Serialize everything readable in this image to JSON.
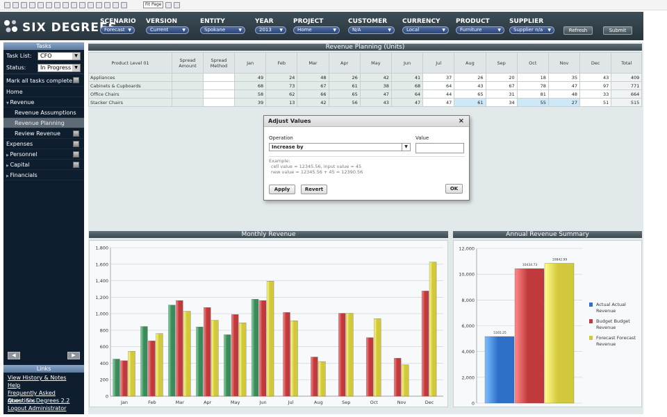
{
  "brand": {
    "name": "SIX DEGREES"
  },
  "toolbar": {
    "zoom": "Fit Page"
  },
  "filters": [
    {
      "label": "SCENARIO",
      "value": "Forecast"
    },
    {
      "label": "VERSION",
      "value": "Current"
    },
    {
      "label": "ENTITY",
      "value": "Spokane"
    },
    {
      "label": "YEAR",
      "value": "2013"
    },
    {
      "label": "PROJECT",
      "value": "Home"
    },
    {
      "label": "CUSTOMER",
      "value": "N/A"
    },
    {
      "label": "CURRENCY",
      "value": "Local"
    },
    {
      "label": "PRODUCT",
      "value": "Furniture"
    },
    {
      "label": "SUPPLIER",
      "value": "Supplier n/a"
    }
  ],
  "buttons": {
    "refresh": "Refresh",
    "submit": "Submit"
  },
  "tasks": {
    "title": "Tasks",
    "task_list_label": "Task List:",
    "task_list_value": "CFO",
    "status_label": "Status:",
    "status_value": "In Progress",
    "mark_all": "Mark all tasks complete",
    "items": [
      {
        "label": "Home",
        "indent": 0,
        "arrow": "",
        "checkbox": false,
        "selected": false
      },
      {
        "label": "Revenue",
        "indent": 0,
        "arrow": "▼",
        "checkbox": false,
        "selected": false
      },
      {
        "label": "Revenue Assumptions",
        "indent": 1,
        "arrow": "",
        "checkbox": false,
        "selected": false
      },
      {
        "label": "Revenue Planning",
        "indent": 1,
        "arrow": "",
        "checkbox": false,
        "selected": true
      },
      {
        "label": "Review Revenue",
        "indent": 1,
        "arrow": "",
        "checkbox": true,
        "selected": false
      },
      {
        "label": "Expenses",
        "indent": 0,
        "arrow": "",
        "checkbox": true,
        "selected": false
      },
      {
        "label": "Personnel",
        "indent": 0,
        "arrow": "▶",
        "checkbox": true,
        "selected": false
      },
      {
        "label": "Capital",
        "indent": 0,
        "arrow": "▶",
        "checkbox": true,
        "selected": false
      },
      {
        "label": "Financials",
        "indent": 0,
        "arrow": "▶",
        "checkbox": false,
        "selected": false
      }
    ]
  },
  "links": {
    "title": "Links",
    "items": [
      "View History & Notes",
      "Help",
      "Frequently Asked Questions",
      "About Six Degrees 2.2",
      "Logout Administrator"
    ]
  },
  "planning": {
    "title": "Revenue Planning (Units)",
    "headers": [
      "Product Level 01",
      "Spread Amount",
      "Spread Method",
      "Jan",
      "Feb",
      "Mar",
      "Apr",
      "May",
      "Jun",
      "Jul",
      "Aug",
      "Sep",
      "Oct",
      "Nov",
      "Dec",
      "Total"
    ],
    "rows": [
      {
        "label": "Appliances",
        "values": [
          49,
          24,
          48,
          26,
          42,
          41,
          37,
          26,
          20,
          18,
          35,
          43
        ],
        "total": 409
      },
      {
        "label": "Cabinets & Cupboards",
        "values": [
          68,
          73,
          67,
          61,
          38,
          68,
          64,
          43,
          67,
          78,
          47,
          97
        ],
        "total": 771
      },
      {
        "label": "Office Chairs",
        "values": [
          58,
          62,
          66,
          65,
          47,
          64,
          44,
          65,
          31,
          81,
          48,
          33
        ],
        "total": 664
      },
      {
        "label": "Stacker Chairs",
        "values": [
          39,
          13,
          42,
          56,
          43,
          47,
          47,
          61,
          34,
          55,
          27,
          51
        ],
        "total": 515
      }
    ]
  },
  "dialog": {
    "title": "Adjust Values",
    "operation_label": "Operation",
    "value_label": "Value",
    "operation_value": "Increase by",
    "example_title": "Example:",
    "example_line1": "cell value = 12345.56, input value = 45",
    "example_line2": "new value = 12345.56 + 45 = 12390.56",
    "apply": "Apply",
    "revert": "Revert",
    "ok": "OK"
  },
  "charts": {
    "monthly_title": "Monthly Revenue",
    "annual_title": "Annual Revenue Summary"
  },
  "chart_data": [
    {
      "type": "bar",
      "title": "Monthly Revenue",
      "categories": [
        "Jan",
        "Feb",
        "Mar",
        "Apr",
        "May",
        "Jun",
        "Jul",
        "Aug",
        "Sep",
        "Oct",
        "Nov",
        "Dec"
      ],
      "series": [
        {
          "name": "",
          "color": "#3c8a5a",
          "values": [
            450,
            845,
            1105,
            840,
            745,
            1175,
            null,
            null,
            null,
            null,
            null,
            null
          ]
        },
        {
          "name": "",
          "color": "#c0393b",
          "values": [
            430,
            670,
            1160,
            1075,
            990,
            1160,
            1015,
            475,
            1005,
            710,
            460,
            1275
          ]
        },
        {
          "name": "",
          "color": "#d2c83c",
          "values": [
            545,
            760,
            1030,
            920,
            890,
            1395,
            915,
            420,
            1005,
            940,
            380,
            1625
          ]
        }
      ],
      "ylim": [
        0,
        1800
      ],
      "yticks": [
        0,
        200,
        400,
        600,
        800,
        1000,
        1200,
        1400,
        1600,
        1800
      ],
      "grid": true
    },
    {
      "type": "bar",
      "title": "Annual Revenue Summary",
      "categories": [
        ""
      ],
      "series": [
        {
          "name": "Actual Actual Revenue",
          "color": "#2e6fc8",
          "value": 5165.25,
          "label": "5165.25"
        },
        {
          "name": "Budget Budget Revenue",
          "color": "#c0393b",
          "value": 10434.73,
          "label": "10434.73"
        },
        {
          "name": "Forecast Forecast Revenue",
          "color": "#d2c83c",
          "value": 10842.99,
          "label": "10842.99"
        }
      ],
      "ylim": [
        0,
        12000
      ],
      "yticks": [
        0,
        2000,
        4000,
        6000,
        8000,
        10000,
        12000
      ],
      "grid": true,
      "legend": "right"
    }
  ]
}
